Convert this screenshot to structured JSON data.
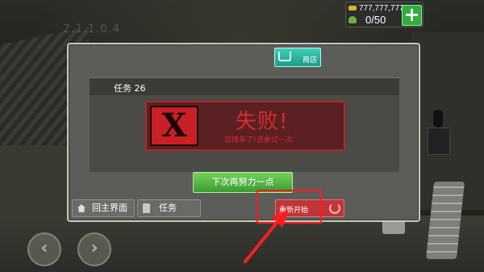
{
  "background": {
    "blurred_text": "2.1.1.0.4"
  },
  "hud": {
    "coins": "777,777,777",
    "fuel": "0/50",
    "add_label": "+"
  },
  "modal": {
    "shop_label": "商店",
    "task_title": "任务 26",
    "fail_icon": "X",
    "fail_title": "失败!",
    "fail_subtitle": "您撞车了!请重试一次",
    "retry_label": "下次再努力一点",
    "menu_label": "回主界面",
    "task_label": "任务",
    "restart_label": "重新开始"
  },
  "controls": {
    "left_arrow": "‹",
    "right_arrow": "›"
  },
  "colors": {
    "accent_green": "#2fae3e",
    "fail_red": "#d72a2f",
    "shop_teal": "#1b9a87",
    "annotation_red": "#ff1d1d"
  },
  "icons": [
    "coin-icon",
    "gem-icon",
    "cart-icon",
    "home-icon",
    "task-icon",
    "refresh-icon",
    "steer-left-icon",
    "steer-right-icon"
  ]
}
